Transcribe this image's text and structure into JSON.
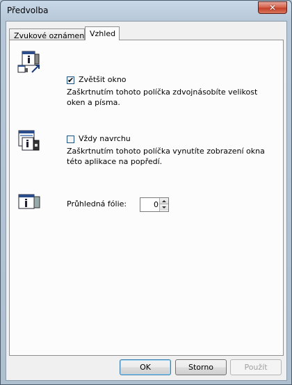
{
  "window": {
    "title": "Předvolba",
    "close_glyph": "✕"
  },
  "tabs": [
    {
      "label": "Zvukové oznámení",
      "selected": false
    },
    {
      "label": "Vzhled",
      "selected": true
    }
  ],
  "options": {
    "enlarge": {
      "label": "Zvětšit okno",
      "checked": true,
      "check_glyph": "✔",
      "description": "Zaškrtnutím tohoto políčka zdvojnásobíte velikost oken a písma."
    },
    "on_top": {
      "label": "Vždy navrchu",
      "checked": false,
      "description": "Zaškrtnutím tohoto políčka vynutíte zobrazení okna této aplikace na popředí."
    },
    "transparency": {
      "label": "Průhledná fólie:",
      "value": "0"
    }
  },
  "buttons": {
    "ok": "OK",
    "cancel": "Storno",
    "apply": "Použít"
  }
}
